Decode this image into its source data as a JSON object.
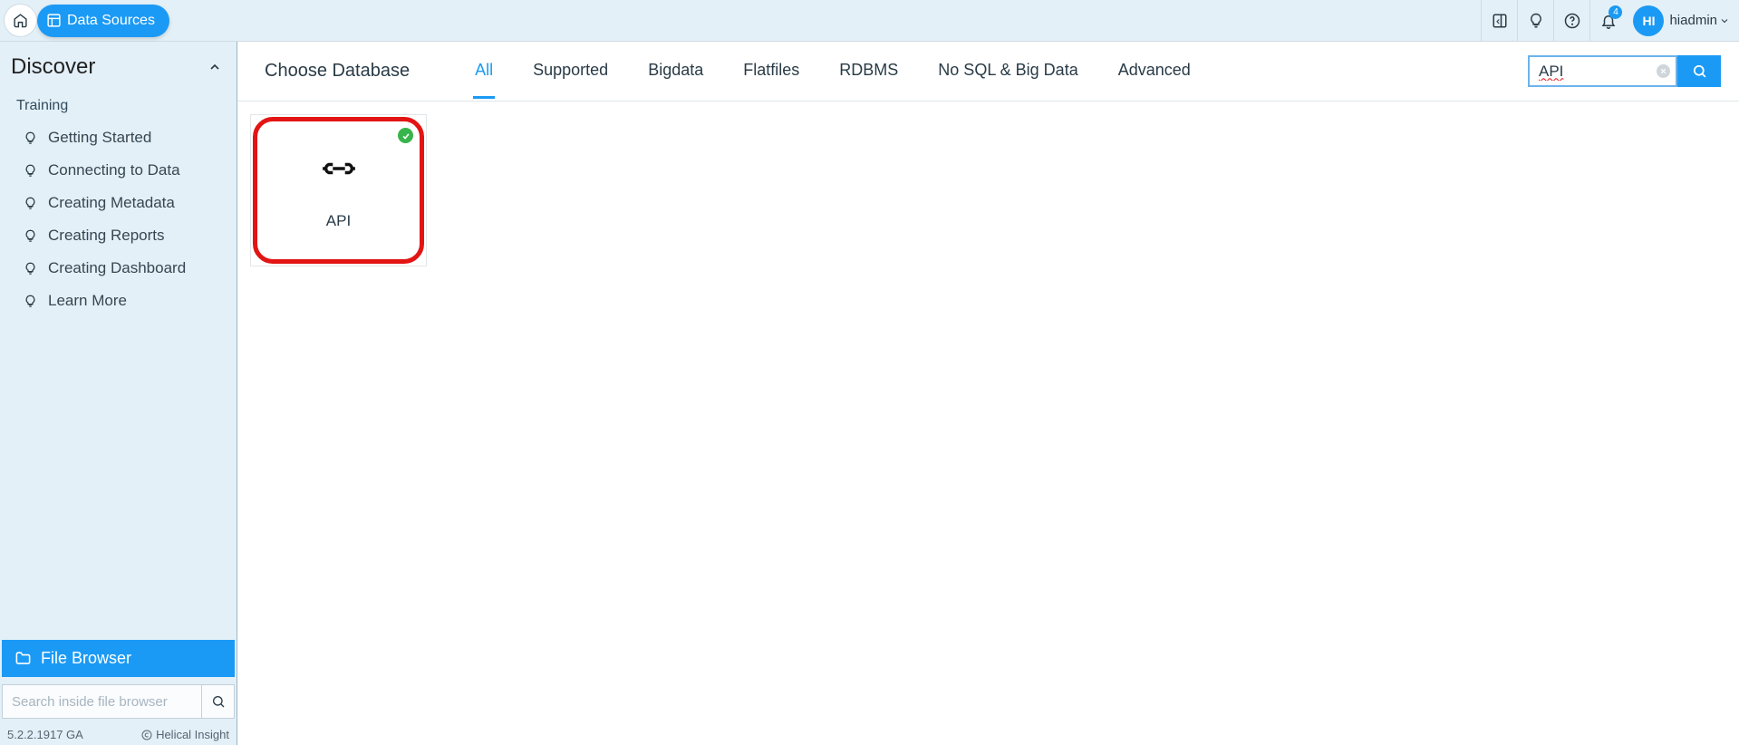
{
  "breadcrumb": {
    "current": "Data Sources"
  },
  "topbar": {
    "notification_count": "4",
    "avatar_initials": "HI",
    "username": "hiadmin"
  },
  "sidebar": {
    "title": "Discover",
    "section": "Training",
    "items": [
      {
        "label": "Getting Started"
      },
      {
        "label": "Connecting to Data"
      },
      {
        "label": "Creating Metadata"
      },
      {
        "label": "Creating Reports"
      },
      {
        "label": "Creating Dashboard"
      },
      {
        "label": "Learn More"
      }
    ],
    "file_browser_label": "File Browser",
    "search_placeholder": "Search inside file browser",
    "version": "5.2.2.1917 GA",
    "copyright": "Helical Insight"
  },
  "subheader": {
    "title": "Choose Database",
    "tabs": [
      {
        "label": "All",
        "active": true
      },
      {
        "label": "Supported",
        "active": false
      },
      {
        "label": "Bigdata",
        "active": false
      },
      {
        "label": "Flatfiles",
        "active": false
      },
      {
        "label": "RDBMS",
        "active": false
      },
      {
        "label": "No SQL & Big Data",
        "active": false
      },
      {
        "label": "Advanced",
        "active": false
      }
    ],
    "search_value": "API"
  },
  "cards": [
    {
      "label": "API",
      "verified": true,
      "highlighted": true
    }
  ]
}
